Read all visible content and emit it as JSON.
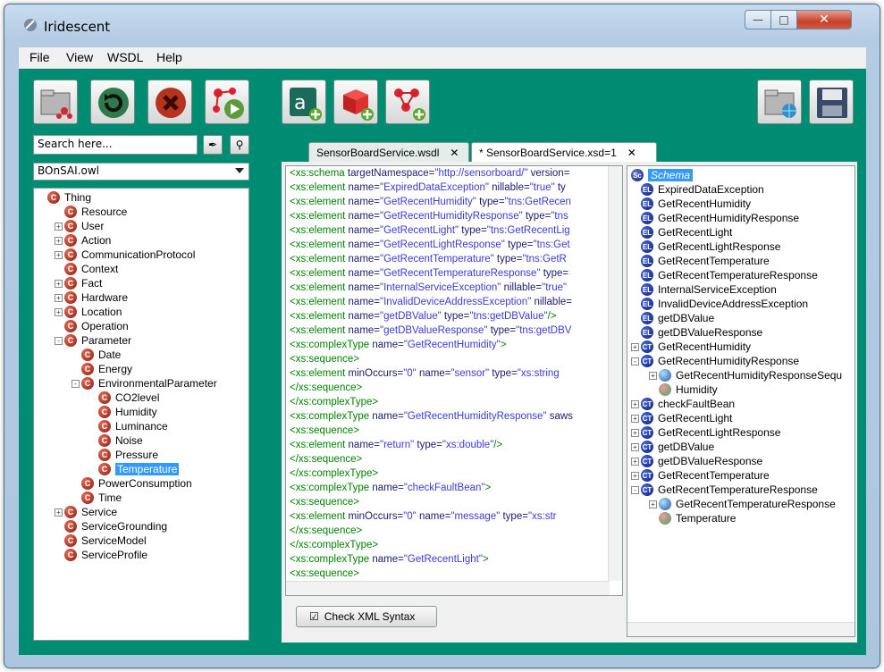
{
  "window": {
    "title": "Iridescent"
  },
  "menu": [
    "File",
    "View",
    "WSDL",
    "Help"
  ],
  "left": {
    "search_placeholder": "Search here...",
    "ontology": "BOnSAI.owl",
    "tree": [
      {
        "label": "Thing",
        "depth": 0,
        "exp": ""
      },
      {
        "label": "Resource",
        "depth": 1,
        "exp": ""
      },
      {
        "label": "User",
        "depth": 1,
        "exp": "+"
      },
      {
        "label": "Action",
        "depth": 1,
        "exp": "+"
      },
      {
        "label": "CommunicationProtocol",
        "depth": 1,
        "exp": "+"
      },
      {
        "label": "Context",
        "depth": 1,
        "exp": ""
      },
      {
        "label": "Fact",
        "depth": 1,
        "exp": "+"
      },
      {
        "label": "Hardware",
        "depth": 1,
        "exp": "+"
      },
      {
        "label": "Location",
        "depth": 1,
        "exp": "+"
      },
      {
        "label": "Operation",
        "depth": 1,
        "exp": ""
      },
      {
        "label": "Parameter",
        "depth": 1,
        "exp": "-"
      },
      {
        "label": "Date",
        "depth": 2,
        "exp": ""
      },
      {
        "label": "Energy",
        "depth": 2,
        "exp": ""
      },
      {
        "label": "EnvironmentalParameter",
        "depth": 2,
        "exp": "-"
      },
      {
        "label": "CO2level",
        "depth": 3,
        "exp": ""
      },
      {
        "label": "Humidity",
        "depth": 3,
        "exp": ""
      },
      {
        "label": "Luminance",
        "depth": 3,
        "exp": ""
      },
      {
        "label": "Noise",
        "depth": 3,
        "exp": ""
      },
      {
        "label": "Pressure",
        "depth": 3,
        "exp": ""
      },
      {
        "label": "Temperature",
        "depth": 3,
        "exp": "",
        "selected": true
      },
      {
        "label": "PowerConsumption",
        "depth": 2,
        "exp": ""
      },
      {
        "label": "Time",
        "depth": 2,
        "exp": ""
      },
      {
        "label": "Service",
        "depth": 1,
        "exp": "+"
      },
      {
        "label": "ServiceGrounding",
        "depth": 1,
        "exp": ""
      },
      {
        "label": "ServiceModel",
        "depth": 1,
        "exp": ""
      },
      {
        "label": "ServiceProfile",
        "depth": 1,
        "exp": ""
      }
    ]
  },
  "tabs": [
    "SensorBoardService.wsdl",
    "* SensorBoardService.xsd=1"
  ],
  "xml_lines": [
    [
      [
        "tg",
        "<xs:schema "
      ],
      [
        "at",
        "targetNamespace="
      ],
      [
        "vl",
        "\"http://sensorboard/\""
      ],
      [
        "at",
        " version="
      ]
    ],
    [
      [
        "tg",
        " <xs:element "
      ],
      [
        "at",
        "name="
      ],
      [
        "vl",
        "\"ExpiredDataException\""
      ],
      [
        "at",
        " nillable="
      ],
      [
        "vl",
        "\"true\""
      ],
      [
        "at",
        " ty"
      ]
    ],
    [
      [
        "tg",
        " <xs:element "
      ],
      [
        "at",
        "name="
      ],
      [
        "vl",
        "\"GetRecentHumidity\""
      ],
      [
        "at",
        " type="
      ],
      [
        "vl",
        "\"tns:GetRecen"
      ]
    ],
    [
      [
        "tg",
        " <xs:element "
      ],
      [
        "at",
        "name="
      ],
      [
        "vl",
        "\"GetRecentHumidityResponse\""
      ],
      [
        "at",
        " type="
      ],
      [
        "vl",
        "\"tns"
      ]
    ],
    [
      [
        "tg",
        " <xs:element "
      ],
      [
        "at",
        "name="
      ],
      [
        "vl",
        "\"GetRecentLight\""
      ],
      [
        "at",
        " type="
      ],
      [
        "vl",
        "\"tns:GetRecentLig"
      ]
    ],
    [
      [
        "tg",
        " <xs:element "
      ],
      [
        "at",
        "name="
      ],
      [
        "vl",
        "\"GetRecentLightResponse\""
      ],
      [
        "at",
        " type="
      ],
      [
        "vl",
        "\"tns:Get"
      ]
    ],
    [
      [
        "tg",
        " <xs:element "
      ],
      [
        "at",
        "name="
      ],
      [
        "vl",
        "\"GetRecentTemperature\""
      ],
      [
        "at",
        " type="
      ],
      [
        "vl",
        "\"tns:GetR"
      ]
    ],
    [
      [
        "tg",
        " <xs:element "
      ],
      [
        "at",
        "name="
      ],
      [
        "vl",
        "\"GetRecentTemperatureResponse\""
      ],
      [
        "at",
        " type="
      ]
    ],
    [
      [
        "tg",
        " <xs:element "
      ],
      [
        "at",
        "name="
      ],
      [
        "vl",
        "\"InternalServiceException\""
      ],
      [
        "at",
        " nillable="
      ],
      [
        "vl",
        "\"true\""
      ]
    ],
    [
      [
        "tg",
        " <xs:element "
      ],
      [
        "at",
        "name="
      ],
      [
        "vl",
        "\"InvalidDeviceAddressException\""
      ],
      [
        "at",
        " nillable="
      ]
    ],
    [
      [
        "tg",
        " <xs:element "
      ],
      [
        "at",
        "name="
      ],
      [
        "vl",
        "\"getDBValue\""
      ],
      [
        "at",
        " type="
      ],
      [
        "vl",
        "\"tns:getDBValue\""
      ],
      [
        "tg",
        "/>"
      ]
    ],
    [
      [
        "tg",
        " <xs:element "
      ],
      [
        "at",
        "name="
      ],
      [
        "vl",
        "\"getDBValueResponse\""
      ],
      [
        "at",
        " type="
      ],
      [
        "vl",
        "\"tns:getDBV"
      ]
    ],
    [
      [
        "tg",
        " <xs:complexType "
      ],
      [
        "at",
        "name="
      ],
      [
        "vl",
        "\"GetRecentHumidity\""
      ],
      [
        "tg",
        ">"
      ]
    ],
    [
      [
        "tg",
        "  <xs:sequence>"
      ]
    ],
    [
      [
        "tg",
        "   <xs:element "
      ],
      [
        "at",
        "minOccurs="
      ],
      [
        "vl",
        "\"0\""
      ],
      [
        "at",
        " name="
      ],
      [
        "vl",
        "\"sensor\""
      ],
      [
        "at",
        " type="
      ],
      [
        "vl",
        "\"xs:string"
      ]
    ],
    [
      [
        "tg",
        "  </xs:sequence>"
      ]
    ],
    [
      [
        "tg",
        " </xs:complexType>"
      ]
    ],
    [
      [
        "tg",
        " <xs:complexType "
      ],
      [
        "at",
        "name="
      ],
      [
        "vl",
        "\"GetRecentHumidityResponse\""
      ],
      [
        "at",
        " saws"
      ]
    ],
    [
      [
        "tg",
        "  <xs:sequence>"
      ]
    ],
    [
      [
        "tg",
        "   <xs:element "
      ],
      [
        "at",
        "name="
      ],
      [
        "vl",
        "\"return\""
      ],
      [
        "at",
        " type="
      ],
      [
        "vl",
        "\"xs:double\""
      ],
      [
        "tg",
        "/>"
      ]
    ],
    [
      [
        "tg",
        "  </xs:sequence>"
      ]
    ],
    [
      [
        "tg",
        " </xs:complexType>"
      ]
    ],
    [
      [
        "tg",
        " <xs:complexType "
      ],
      [
        "at",
        "name="
      ],
      [
        "vl",
        "\"checkFaultBean\""
      ],
      [
        "tg",
        ">"
      ]
    ],
    [
      [
        "tg",
        "  <xs:sequence>"
      ]
    ],
    [
      [
        "tg",
        "   <xs:element "
      ],
      [
        "at",
        "minOccurs="
      ],
      [
        "vl",
        "\"0\""
      ],
      [
        "at",
        " name="
      ],
      [
        "vl",
        "\"message\""
      ],
      [
        "at",
        " type="
      ],
      [
        "vl",
        "\"xs:str"
      ]
    ],
    [
      [
        "tg",
        "  </xs:sequence>"
      ]
    ],
    [
      [
        "tg",
        " </xs:complexType>"
      ]
    ],
    [
      [
        "tg",
        " <xs:complexType "
      ],
      [
        "at",
        "name="
      ],
      [
        "vl",
        "\"GetRecentLight\""
      ],
      [
        "tg",
        ">"
      ]
    ],
    [
      [
        "tg",
        "  <xs:sequence>"
      ]
    ]
  ],
  "check_button": "Check XML Syntax",
  "schema_tree": [
    {
      "label": "Schema",
      "depth": 0,
      "icon": "Sc",
      "exp": "",
      "selected": true
    },
    {
      "label": "ExpiredDataException",
      "depth": 1,
      "icon": "EL",
      "exp": ""
    },
    {
      "label": "GetRecentHumidity",
      "depth": 1,
      "icon": "EL",
      "exp": ""
    },
    {
      "label": "GetRecentHumidityResponse",
      "depth": 1,
      "icon": "EL",
      "exp": ""
    },
    {
      "label": "GetRecentLight",
      "depth": 1,
      "icon": "EL",
      "exp": ""
    },
    {
      "label": "GetRecentLightResponse",
      "depth": 1,
      "icon": "EL",
      "exp": ""
    },
    {
      "label": "GetRecentTemperature",
      "depth": 1,
      "icon": "EL",
      "exp": ""
    },
    {
      "label": "GetRecentTemperatureResponse",
      "depth": 1,
      "icon": "EL",
      "exp": ""
    },
    {
      "label": "InternalServiceException",
      "depth": 1,
      "icon": "EL",
      "exp": ""
    },
    {
      "label": "InvalidDeviceAddressException",
      "depth": 1,
      "icon": "EL",
      "exp": ""
    },
    {
      "label": "getDBValue",
      "depth": 1,
      "icon": "EL",
      "exp": ""
    },
    {
      "label": "getDBValueResponse",
      "depth": 1,
      "icon": "EL",
      "exp": ""
    },
    {
      "label": "GetRecentHumidity",
      "depth": 1,
      "icon": "CT",
      "exp": "+"
    },
    {
      "label": "GetRecentHumidityResponse",
      "depth": 1,
      "icon": "CT",
      "exp": "-"
    },
    {
      "label": "GetRecentHumidityResponseSequ",
      "depth": 2,
      "icon": "globe",
      "exp": "+"
    },
    {
      "label": "Humidity",
      "depth": 2,
      "icon": "ball",
      "exp": ""
    },
    {
      "label": "checkFaultBean",
      "depth": 1,
      "icon": "CT",
      "exp": "+"
    },
    {
      "label": "GetRecentLight",
      "depth": 1,
      "icon": "CT",
      "exp": "+"
    },
    {
      "label": "GetRecentLightResponse",
      "depth": 1,
      "icon": "CT",
      "exp": "+"
    },
    {
      "label": "getDBValue",
      "depth": 1,
      "icon": "CT",
      "exp": "+"
    },
    {
      "label": "getDBValueResponse",
      "depth": 1,
      "icon": "CT",
      "exp": "+"
    },
    {
      "label": "GetRecentTemperature",
      "depth": 1,
      "icon": "CT",
      "exp": "+"
    },
    {
      "label": "GetRecentTemperatureResponse",
      "depth": 1,
      "icon": "CT",
      "exp": "-"
    },
    {
      "label": "GetRecentTemperatureResponse",
      "depth": 2,
      "icon": "globe",
      "exp": "+"
    },
    {
      "label": "Temperature",
      "depth": 2,
      "icon": "ball",
      "exp": ""
    }
  ]
}
